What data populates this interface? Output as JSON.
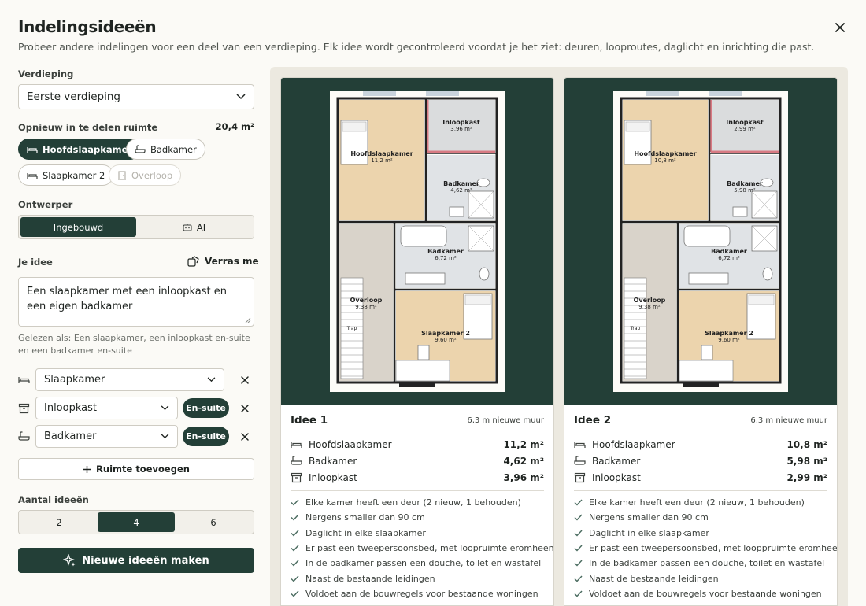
{
  "header": {
    "title": "Indelingsideeën",
    "subtitle": "Probeer andere indelingen voor een deel van een verdieping. Elk idee wordt gecontroleerd voordat je het ziet: deuren, looproutes, daglicht en inrichting die past."
  },
  "floor": {
    "label": "Verdieping",
    "value": "Eerste verdieping"
  },
  "rooms_to_split": {
    "label": "Opnieuw in te delen ruimte",
    "area": "20,4 m²",
    "chips": [
      {
        "label": "Hoofdslaapkamer",
        "icon": "bed-icon",
        "state": "selected"
      },
      {
        "label": "Badkamer",
        "icon": "bath-icon",
        "state": "normal"
      },
      {
        "label": "Slaapkamer 2",
        "icon": "bed-icon",
        "state": "normal"
      },
      {
        "label": "Overloop",
        "icon": "door-icon",
        "state": "disabled"
      }
    ]
  },
  "designer": {
    "label": "Ontwerper",
    "options": [
      "Ingebouwd",
      "AI"
    ],
    "selected": "Ingebouwd"
  },
  "idea": {
    "label": "Je idee",
    "surprise": "Verras me",
    "text": "Een slaapkamer met een inloopkast en een eigen badkamer",
    "parsed": "Gelezen als: Een slaapkamer, een inloopkast en-suite en een badkamer en-suite"
  },
  "room_rows": [
    {
      "icon": "bed-icon",
      "value": "Slaapkamer",
      "ensuite": ""
    },
    {
      "icon": "closet-icon",
      "value": "Inloopkast",
      "ensuite": "En-suite"
    },
    {
      "icon": "bath-icon",
      "value": "Badkamer",
      "ensuite": "En-suite"
    }
  ],
  "add_room": "Ruimte toevoegen",
  "count": {
    "label": "Aantal ideeën",
    "options": [
      "2",
      "4",
      "6"
    ],
    "selected": "4"
  },
  "generate": "Nieuwe ideeën maken",
  "ideas": [
    {
      "title": "Idee 1",
      "meta": "6,3 m nieuwe muur",
      "plan_labels": {
        "master": "Hoofdslaapkamer",
        "master_area": "11,2 m²",
        "closet": "Inloopkast",
        "closet_area": "3,96 m²",
        "bath": "Badkamer",
        "bath_area": "4,62 m²",
        "bath2": "Badkamer",
        "bath2_area": "6,72 m²",
        "landing": "Overloop",
        "landing_area": "9,38 m²",
        "stairs": "Trap",
        "bed2": "Slaapkamer 2",
        "bed2_area": "9,60 m²"
      },
      "rooms": [
        {
          "icon": "bed-icon",
          "name": "Hoofdslaapkamer",
          "area": "11,2 m²"
        },
        {
          "icon": "bath-icon",
          "name": "Badkamer",
          "area": "4,62 m²"
        },
        {
          "icon": "closet-icon",
          "name": "Inloopkast",
          "area": "3,96 m²"
        }
      ],
      "checks": [
        "Elke kamer heeft een deur (2 nieuw, 1 behouden)",
        "Nergens smaller dan 90 cm",
        "Daglicht in elke slaapkamer",
        "Er past een tweepersoonsbed, met loopruimte eromheen",
        "In de badkamer passen een douche, toilet en wastafel",
        "Naast de bestaande leidingen",
        "Voldoet aan de bouwregels voor bestaande woningen"
      ]
    },
    {
      "title": "Idee 2",
      "meta": "6,3 m nieuwe muur",
      "plan_labels": {
        "master": "Hoofdslaapkamer",
        "master_area": "10,8 m²",
        "closet": "Inloopkast",
        "closet_area": "2,99 m²",
        "bath": "Badkamer",
        "bath_area": "5,98 m²",
        "bath2": "Badkamer",
        "bath2_area": "6,72 m²",
        "landing": "Overloop",
        "landing_area": "9,38 m²",
        "stairs": "Trap",
        "bed2": "Slaapkamer 2",
        "bed2_area": "9,60 m²"
      },
      "rooms": [
        {
          "icon": "bed-icon",
          "name": "Hoofdslaapkamer",
          "area": "10,8 m²"
        },
        {
          "icon": "bath-icon",
          "name": "Badkamer",
          "area": "5,98 m²"
        },
        {
          "icon": "closet-icon",
          "name": "Inloopkast",
          "area": "2,99 m²"
        }
      ],
      "checks": [
        "Elke kamer heeft een deur (2 nieuw, 1 behouden)",
        "Nergens smaller dan 90 cm",
        "Daglicht in elke slaapkamer",
        "Er past een tweepersoonsbed, met looppruimte eromheen",
        "In de badkamer passen een douche, toilet en wastafel",
        "Naast de bestaande leidingen",
        "Voldoet aan de bouwregels voor bestaande woningen"
      ]
    }
  ],
  "colors": {
    "accent": "#233f37",
    "wood": "#ecd4ad",
    "tile": "#dfe2e4",
    "landing": "#d9d2c9"
  }
}
